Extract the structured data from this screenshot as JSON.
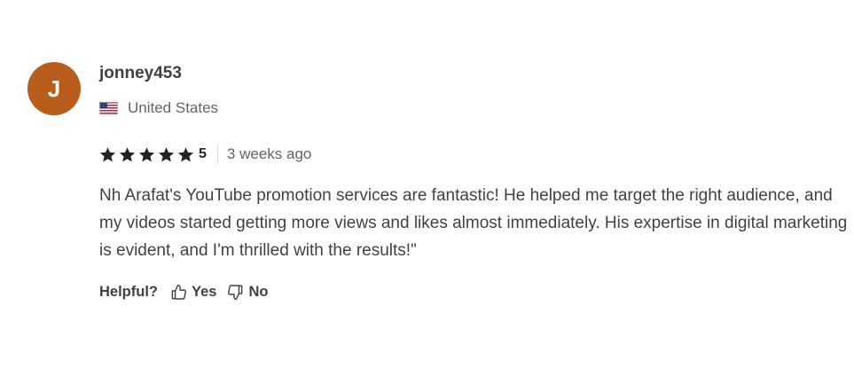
{
  "reviewer": {
    "avatar_initial": "J",
    "avatar_color": "#b85d1b",
    "username": "jonney453",
    "country": "United States",
    "flag_icon": "us-flag-icon"
  },
  "rating": {
    "stars": 5,
    "value": "5",
    "time_ago": "3 weeks ago",
    "star_color": "#222325"
  },
  "review": {
    "text": "Nh Arafat's YouTube promotion services are fantastic! He helped me target the right audience, and my videos started getting more views and likes almost immediately. His expertise in digital marketing is evident, and I'm thrilled with the results!\""
  },
  "helpful": {
    "label": "Helpful?",
    "yes_label": "Yes",
    "no_label": "No"
  }
}
